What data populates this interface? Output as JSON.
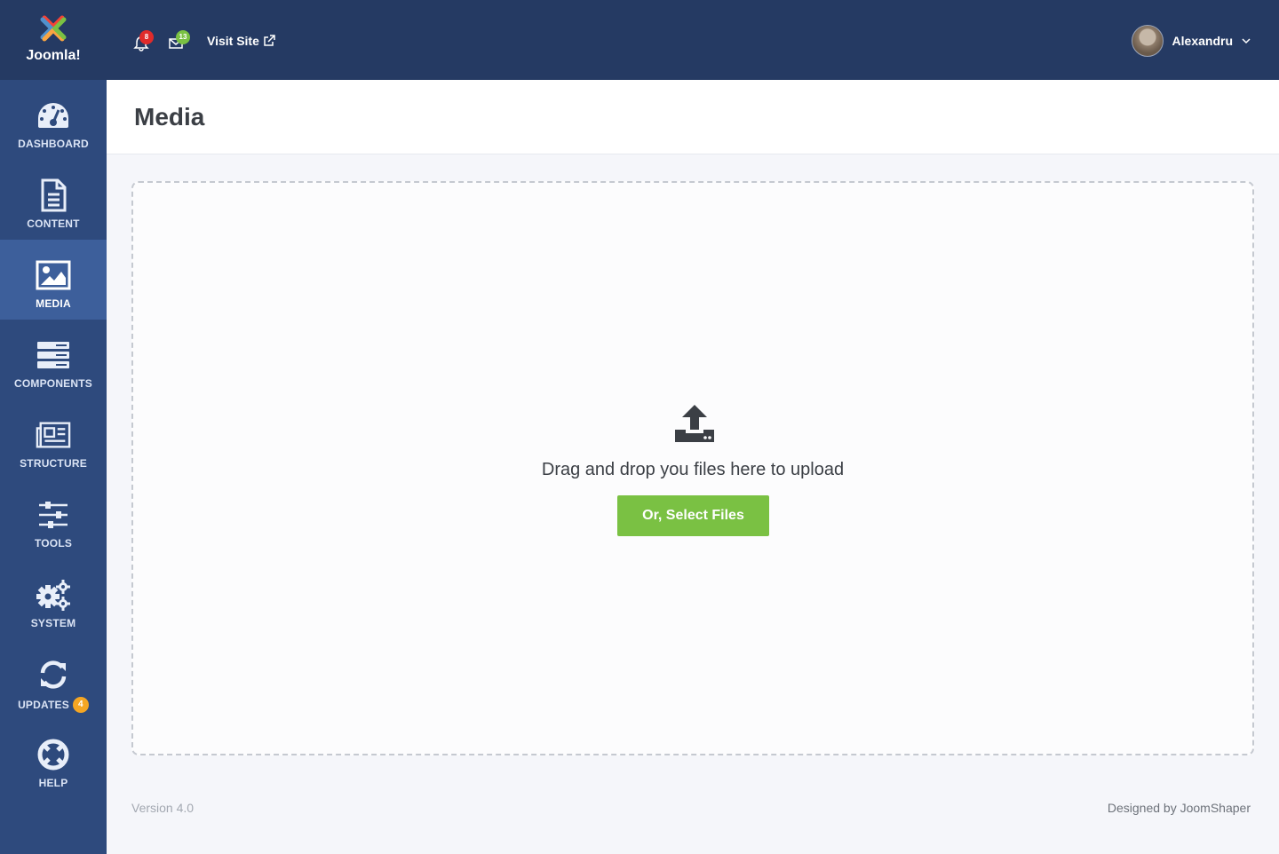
{
  "brand": {
    "name": "Joomla!"
  },
  "sidebar": {
    "items": [
      {
        "label": "DASHBOARD",
        "icon": "dashboard-gauge-icon"
      },
      {
        "label": "CONTENT",
        "icon": "document-icon"
      },
      {
        "label": "MEDIA",
        "icon": "image-icon",
        "active": true
      },
      {
        "label": "COMPONENTS",
        "icon": "components-icon"
      },
      {
        "label": "STRUCTURE",
        "icon": "newspaper-icon"
      },
      {
        "label": "TOOLS",
        "icon": "sliders-icon"
      },
      {
        "label": "SYSTEM",
        "icon": "gears-icon"
      },
      {
        "label": "UPDATES",
        "icon": "refresh-icon",
        "badge": "4"
      },
      {
        "label": "HELP",
        "icon": "lifebuoy-icon"
      }
    ]
  },
  "topbar": {
    "notifications_count": "8",
    "messages_count": "13",
    "visit_site_label": "Visit Site",
    "user_name": "Alexandru"
  },
  "page": {
    "title": "Media"
  },
  "dropzone": {
    "text": "Drag and drop you files here to upload",
    "button_label": "Or, Select Files"
  },
  "footer": {
    "version": "Version 4.0",
    "credit": "Designed by JoomShaper"
  },
  "colors": {
    "topbar": "#253a63",
    "sidebar": "#2e4a7d",
    "sidebar_active": "#3d5f9b",
    "primary_button": "#7ac143",
    "notification_badge": "#e02b2b",
    "message_badge": "#7ac143",
    "updates_badge": "#f5a623"
  }
}
